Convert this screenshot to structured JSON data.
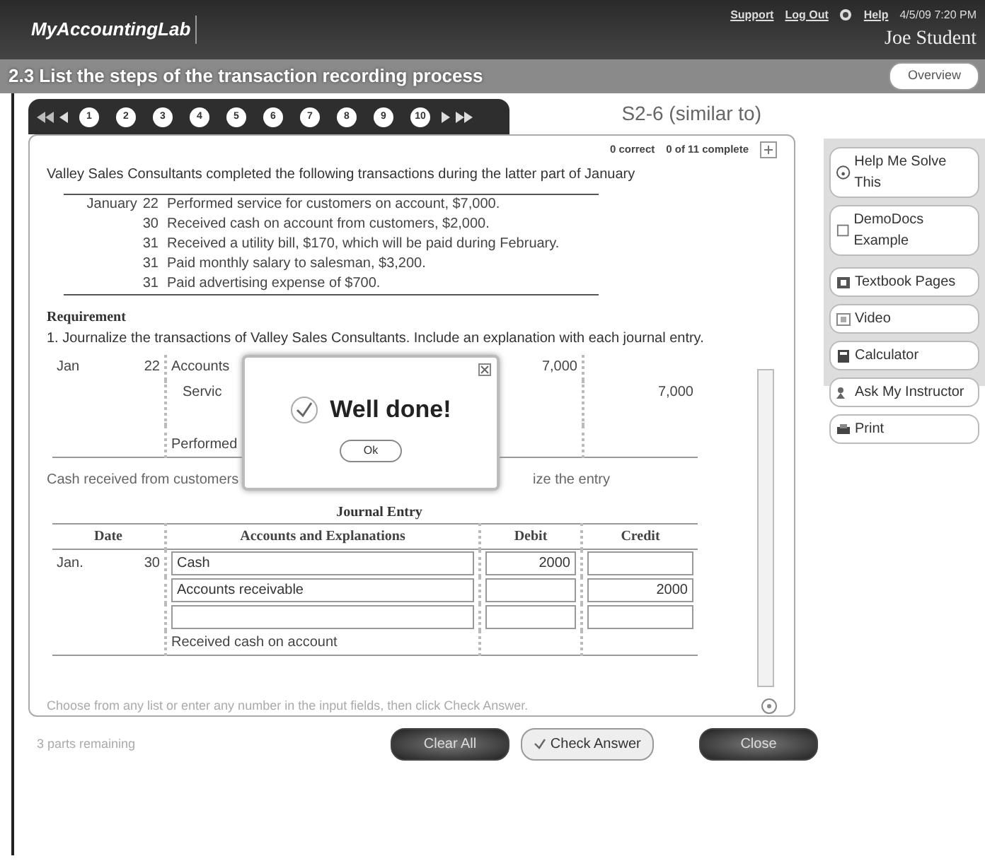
{
  "header": {
    "logo": "MyAccountingLab",
    "links": [
      "Support",
      "Log Out",
      "Help"
    ],
    "datetime": "4/5/09 7:20 PM",
    "user": "Joe Student"
  },
  "title_bar": {
    "title": "2.3 List the steps of the transaction recording process",
    "button": "Overview"
  },
  "question_nav": {
    "numbers": [
      "1",
      "2",
      "3",
      "4",
      "5",
      "6",
      "7",
      "8",
      "9",
      "10"
    ],
    "problem": "S2-6 (similar to)"
  },
  "status": {
    "correct": "0 correct",
    "complete": "0 of 11 complete"
  },
  "problem": {
    "intro": "Valley Sales Consultants completed the following transactions during the latter part of January",
    "transactions": [
      {
        "month": "January",
        "day": "22",
        "text": "Performed service for customers on account, $7,000."
      },
      {
        "day": "30",
        "text": "Received cash on account from customers, $2,000."
      },
      {
        "day": "31",
        "text": "Received a utility bill, $170, which will be paid during February."
      },
      {
        "day": "31",
        "text": "Paid monthly salary to salesman, $3,200."
      },
      {
        "day": "31",
        "text": "Paid advertising expense of $700."
      }
    ],
    "requirement_heading": "Requirement",
    "requirement": "1. Journalize the transactions of Valley Sales Consultants. Include an explanation with each journal entry."
  },
  "answered_entry": {
    "month": "Jan",
    "day": "22",
    "lines": [
      {
        "kind": "debit",
        "account": "Accounts",
        "amount": "7,000"
      },
      {
        "kind": "credit",
        "account": "Servic",
        "amount": "7,000"
      },
      {
        "kind": "explanation",
        "account": "Performed"
      }
    ]
  },
  "prompt": {
    "left": "Cash received from customers",
    "right": "ize the entry"
  },
  "journal": {
    "title": "Journal Entry",
    "columns": [
      "Date",
      "Accounts and Explanations",
      "Debit",
      "Credit"
    ],
    "month": "Jan.",
    "day": "30",
    "lines": [
      {
        "kind": "input",
        "account": "Cash",
        "debit": "2000"
      },
      {
        "kind": "input",
        "account": "Accounts receivable",
        "credit": "2000"
      },
      {
        "kind": "input"
      },
      {
        "kind": "explanation",
        "account": "Received cash on account"
      }
    ]
  },
  "instructions": "Choose from any list or enter any number in the input fields, then click Check Answer.",
  "parts_remaining": "3 parts remaining",
  "buttons": [
    {
      "kind": "dark",
      "label": "Clear All"
    },
    {
      "kind": "check",
      "label": "Check Answer"
    },
    {
      "kind": "dark",
      "label": "Close"
    }
  ],
  "sidebar": [
    "Help Me Solve This",
    "DemoDocs Example",
    "Textbook Pages",
    "Video",
    "Calculator",
    "Ask My Instructor",
    "Print"
  ],
  "dialog": {
    "message": "Well done!",
    "button": "Ok"
  }
}
